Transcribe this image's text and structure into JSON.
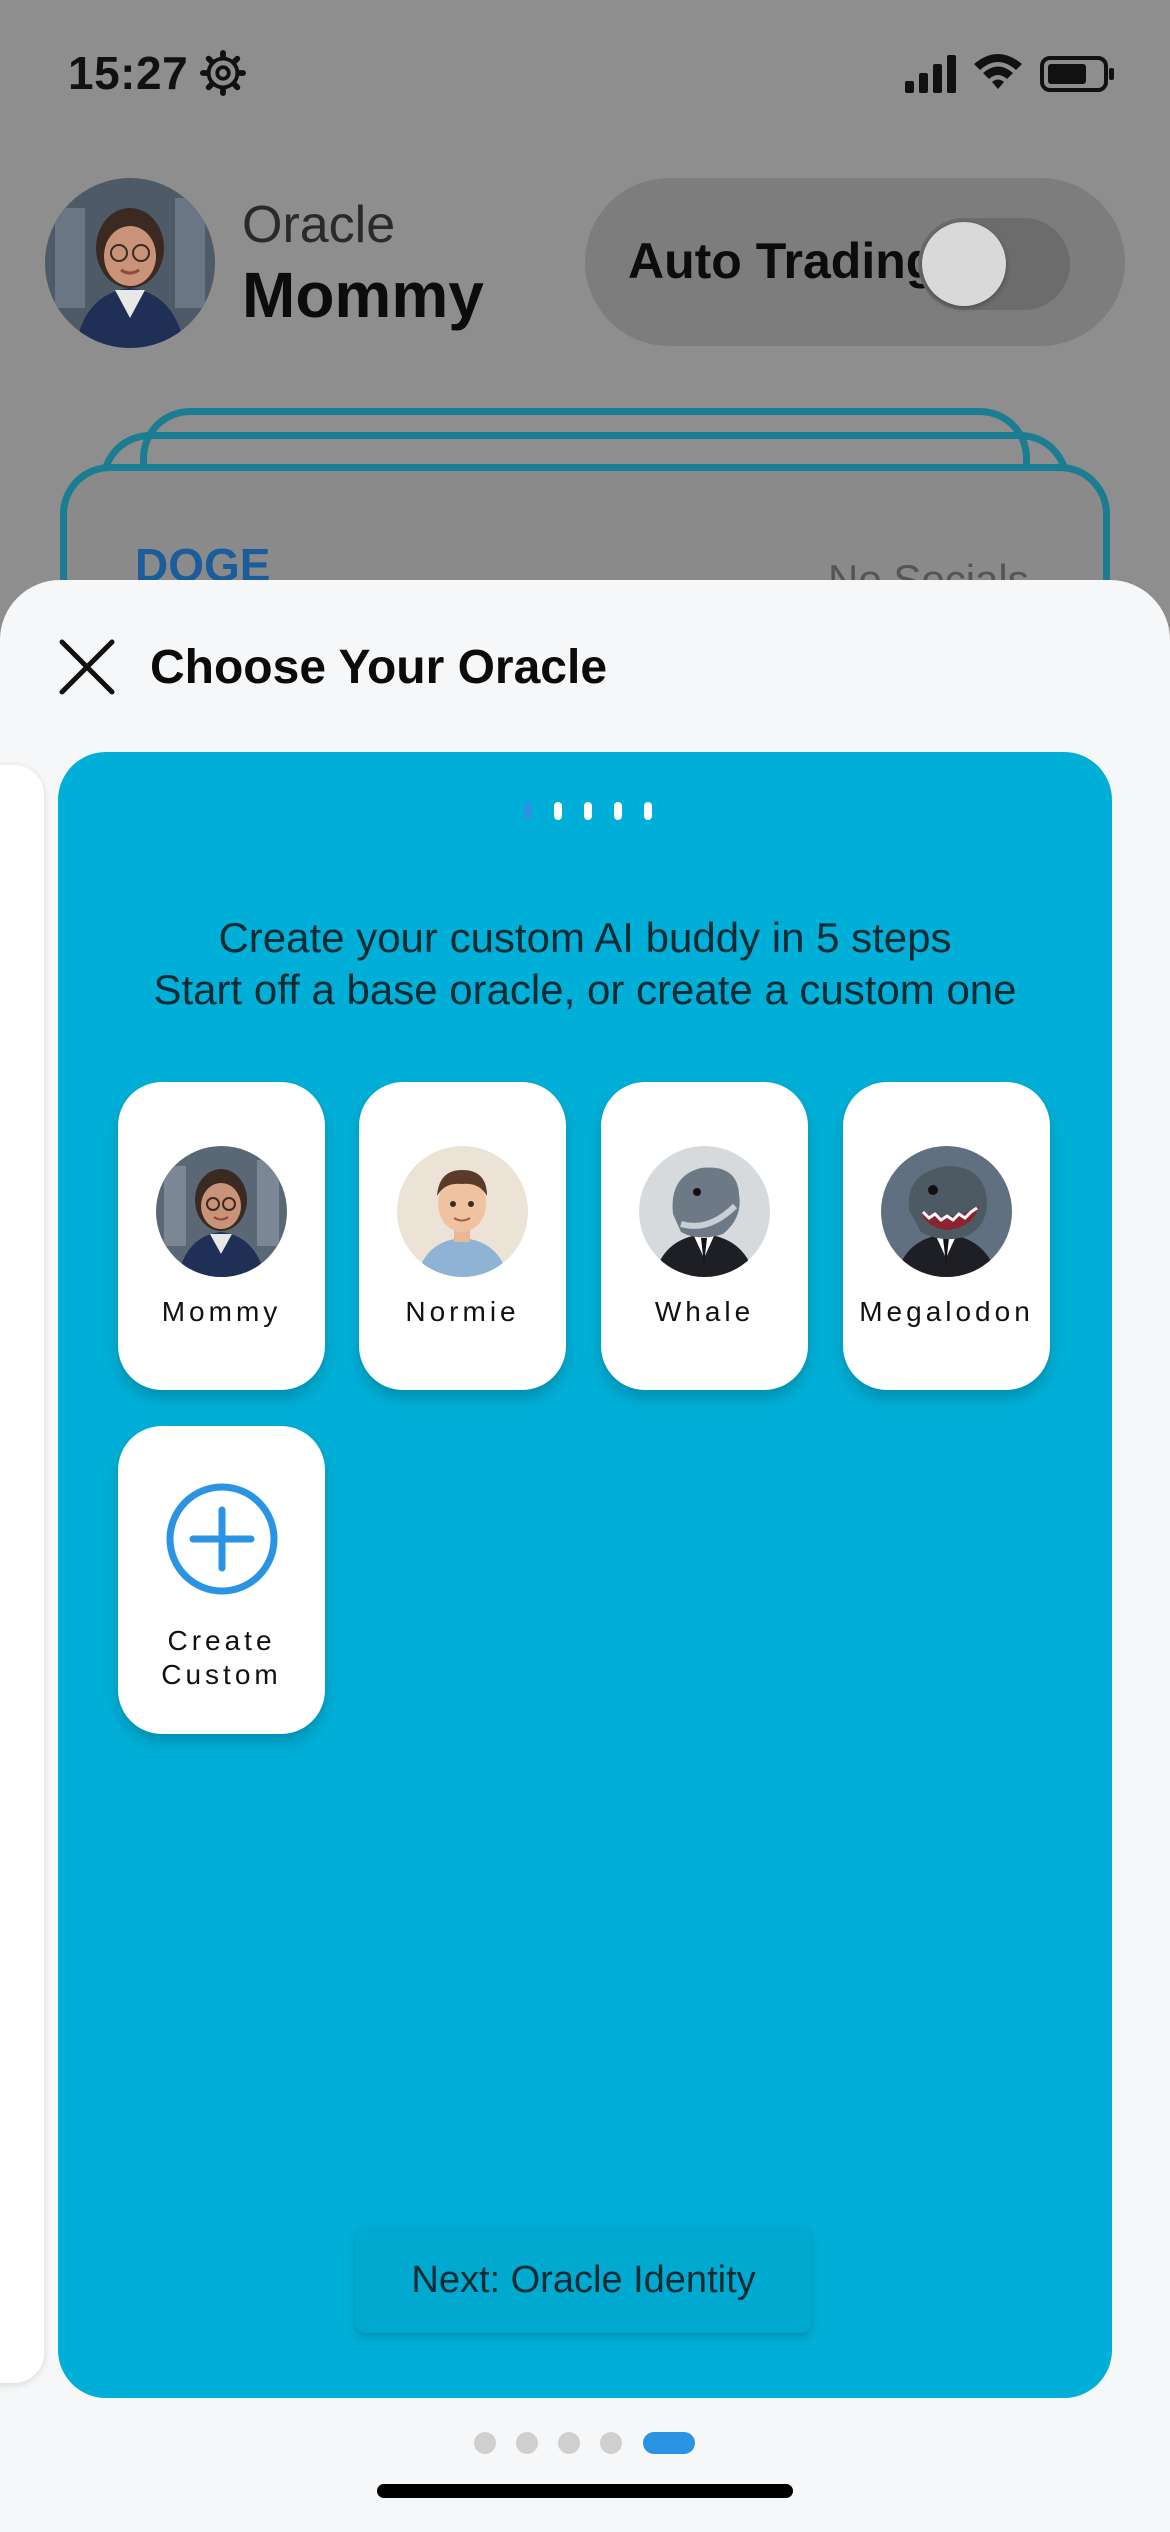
{
  "status_bar": {
    "time": "15:27",
    "icons": [
      "settings-gear-icon",
      "cellular-signal-icon",
      "wifi-icon",
      "battery-icon"
    ]
  },
  "header": {
    "label": "Oracle",
    "name": "Mommy",
    "auto_trading_label": "Auto Trading",
    "auto_trading_on": false
  },
  "background_card": {
    "ticker": "DOGE",
    "socials": "No Socials"
  },
  "sheet": {
    "title": "Choose Your Oracle",
    "intro_line1": "Create your custom AI buddy in 5 steps",
    "intro_line2": "Start off a base oracle, or create a custom one",
    "oracles": [
      {
        "name": "Mommy"
      },
      {
        "name": "Normie"
      },
      {
        "name": "Whale"
      },
      {
        "name": "Megalodon"
      }
    ],
    "custom_line1": "Create",
    "custom_line2": "Custom",
    "next_label": "Next: Oracle Identity",
    "wizard_steps_total": 5,
    "wizard_step_current": 1,
    "pager_total": 5,
    "pager_current": 5
  },
  "colors": {
    "wizard_bg": "#00afd7",
    "accent": "#2b93e3",
    "dim_bg": "#8e8e8e"
  }
}
